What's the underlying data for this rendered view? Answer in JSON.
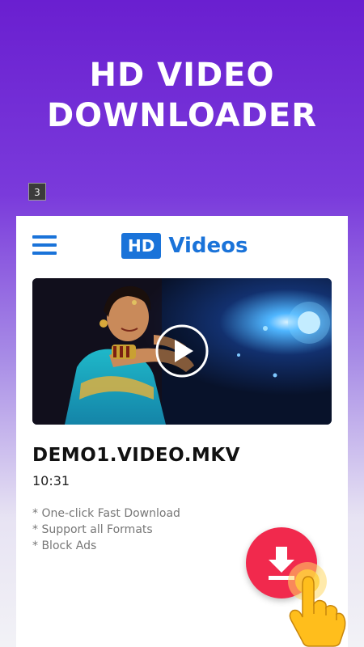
{
  "headline": {
    "line1": "HD VIDEO",
    "line2": "DOWNLOADER"
  },
  "badge": "3",
  "app": {
    "brand_hd": "HD",
    "brand_text": "Videos"
  },
  "video": {
    "title": "DEMO1.VIDEO.MKV",
    "duration": "10:31"
  },
  "features": [
    "One-click Fast Download",
    "Support all Formats",
    "Block Ads"
  ],
  "icons": {
    "menu": "hamburger-menu-icon",
    "play": "play-icon",
    "download": "download-icon",
    "hand": "pointing-hand-icon"
  },
  "colors": {
    "brand_blue": "#1a73d9",
    "fab_red": "#f1294d",
    "bg_purple": "#6a1fd0"
  }
}
